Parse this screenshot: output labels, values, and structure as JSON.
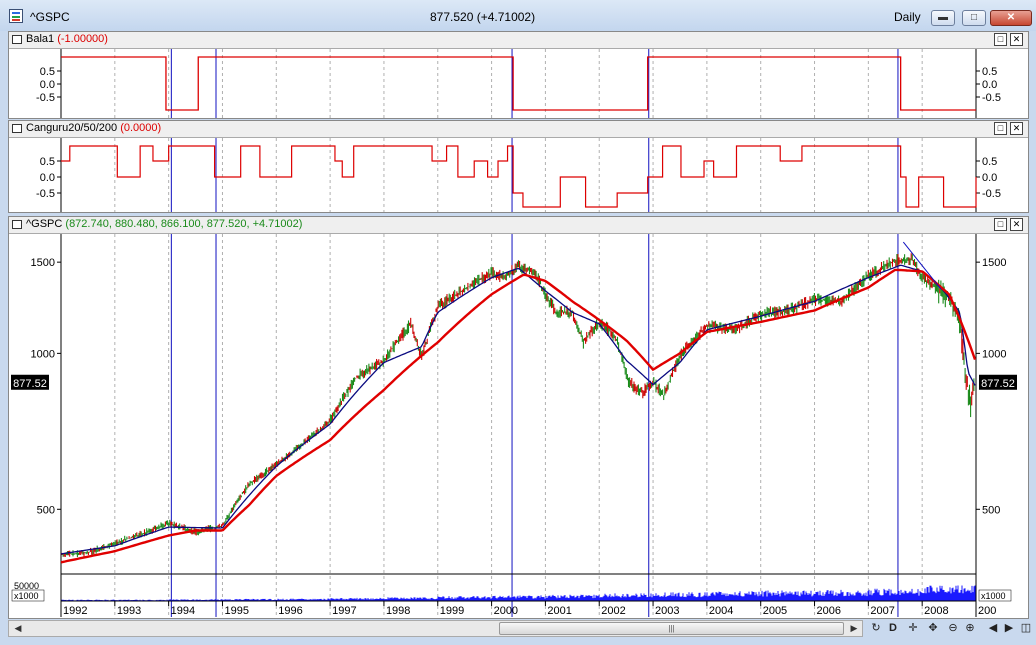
{
  "window": {
    "title": "^GSPC",
    "last_change": "877.520 (+4.71002)",
    "period": "Daily",
    "min_icon": "minimize-icon",
    "max_icon": "maximize-icon",
    "close_icon": "close-icon"
  },
  "panes": {
    "bala": {
      "name": "Bala1",
      "value": "(-1.00000)"
    },
    "canguru": {
      "name": "Canguru20/50/200",
      "value": "(0.0000)"
    },
    "price": {
      "name": "^GSPC",
      "values": "(872.740, 880.480, 866.100, 877.520, +4.71002)"
    },
    "volume": {
      "scale_label": "x1000",
      "top_label": "50000"
    }
  },
  "toolbar": {
    "buttons": [
      "refresh-icon",
      "D",
      "crosshair-icon",
      "zoom-out-icon",
      "zoom-in-icon",
      "prev-icon",
      "next-icon",
      "split-icon"
    ]
  },
  "colors": {
    "signal": "#dd0000",
    "price_up": "#1a8a1a",
    "price_down": "#cc0000",
    "ma_fast": "#0a0a80",
    "ma_slow": "#e00000",
    "marker": "#1010c0",
    "volume": "#1a1aff"
  },
  "chart_data": [
    {
      "type": "line",
      "title": "Bala1",
      "x_domain": [
        1992.0,
        2009.0
      ],
      "yticks": [
        "0.5",
        "0.0",
        "-0.5"
      ],
      "ylim": [
        -1,
        1
      ],
      "steps": [
        [
          1992.0,
          1
        ],
        [
          1993.95,
          -1
        ],
        [
          1994.55,
          1
        ],
        [
          2000.4,
          -1
        ],
        [
          2002.9,
          1
        ],
        [
          2007.6,
          -1
        ],
        [
          2009.0,
          -1
        ]
      ]
    },
    {
      "type": "line",
      "title": "Canguru20/50/200",
      "x_domain": [
        1992.0,
        2009.0
      ],
      "yticks": [
        "0.5",
        "0.0",
        "-0.5"
      ],
      "ylim": [
        -1,
        1
      ],
      "regimes": [
        [
          1992.0,
          2000.4,
          "up"
        ],
        [
          2000.4,
          2002.9,
          "down"
        ],
        [
          2002.9,
          2007.6,
          "up"
        ],
        [
          2007.6,
          2009.0,
          "down"
        ]
      ],
      "current": 0
    },
    {
      "type": "line",
      "title": "^GSPC",
      "scale": "log",
      "yticks": [
        1500,
        1000,
        500
      ],
      "ylim": [
        375,
        1700
      ],
      "last_value": 877.52,
      "last_label": "877.52",
      "xticks": [
        "1992",
        "1993",
        "1994",
        "1995",
        "1996",
        "1997",
        "1998",
        "1999",
        "2000",
        "2001",
        "2002",
        "2003",
        "2004",
        "2005",
        "2006",
        "2007",
        "2008",
        "200"
      ],
      "xtick_positions": [
        1992,
        1993,
        1994,
        1995,
        1996,
        1997,
        1998,
        1999,
        2000,
        2001,
        2002,
        2003,
        2004,
        2005,
        2006,
        2007,
        2008,
        2009
      ],
      "markers": [
        1994.05,
        1994.88,
        2000.38,
        2002.92,
        2007.55
      ],
      "series": [
        {
          "name": "price",
          "x": [
            1992.0,
            1992.5,
            1993.0,
            1993.5,
            1994.0,
            1994.5,
            1995.0,
            1995.5,
            1996.0,
            1996.5,
            1997.0,
            1997.5,
            1998.0,
            1998.5,
            1998.7,
            1999.0,
            1999.5,
            2000.0,
            2000.2,
            2000.5,
            2000.8,
            2001.0,
            2001.2,
            2001.5,
            2001.7,
            2002.0,
            2002.3,
            2002.55,
            2002.8,
            2003.0,
            2003.2,
            2003.5,
            2004.0,
            2004.5,
            2005.0,
            2005.5,
            2006.0,
            2006.5,
            2007.0,
            2007.5,
            2007.8,
            2008.0,
            2008.3,
            2008.5,
            2008.7,
            2008.8,
            2008.9,
            2009.0
          ],
          "values": [
            410,
            412,
            430,
            448,
            470,
            452,
            465,
            560,
            610,
            670,
            740,
            900,
            970,
            1140,
            980,
            1230,
            1330,
            1430,
            1400,
            1470,
            1430,
            1300,
            1200,
            1200,
            1050,
            1150,
            1080,
            880,
            840,
            880,
            830,
            990,
            1130,
            1110,
            1190,
            1210,
            1270,
            1260,
            1410,
            1510,
            1520,
            1400,
            1330,
            1280,
            1150,
            900,
            800,
            877.52
          ]
        },
        {
          "name": "ma-fast",
          "x": [
            1992.0,
            1993.0,
            1994.0,
            1995.0,
            1996.0,
            1997.0,
            1998.0,
            1998.7,
            1999.0,
            2000.0,
            2000.5,
            2001.0,
            2001.5,
            2002.0,
            2002.5,
            2003.0,
            2003.5,
            2004.0,
            2005.0,
            2006.0,
            2007.0,
            2007.6,
            2008.0,
            2008.4,
            2008.7,
            2008.85,
            2009.0
          ],
          "values": [
            410,
            425,
            462,
            460,
            605,
            730,
            960,
            1030,
            1200,
            1400,
            1460,
            1320,
            1200,
            1140,
            970,
            870,
            960,
            1110,
            1180,
            1260,
            1400,
            1480,
            1440,
            1320,
            1200,
            920,
            860
          ]
        },
        {
          "name": "ma-slow",
          "x": [
            1992.0,
            1993.0,
            1994.0,
            1994.5,
            1995.0,
            1995.5,
            1996.0,
            1997.0,
            1998.0,
            1999.0,
            2000.0,
            2000.6,
            2001.0,
            2001.5,
            2002.0,
            2002.5,
            2003.0,
            2003.5,
            2004.0,
            2005.0,
            2006.0,
            2007.0,
            2007.5,
            2008.0,
            2008.5,
            2009.0
          ],
          "values": [
            395,
            415,
            445,
            455,
            455,
            510,
            580,
            680,
            850,
            1050,
            1300,
            1420,
            1380,
            1260,
            1160,
            1060,
            930,
            1000,
            1100,
            1150,
            1210,
            1340,
            1450,
            1440,
            1300,
            960
          ]
        }
      ]
    },
    {
      "type": "bar",
      "title": "volume",
      "x_domain": [
        1992.0,
        2009.0
      ],
      "values_relative": [
        0.04,
        0.04,
        0.05,
        0.06,
        0.07,
        0.09,
        0.11,
        0.14,
        0.16,
        0.18,
        0.22,
        0.25,
        0.28,
        0.3,
        0.32,
        0.35,
        0.45,
        0.7,
        0.9
      ]
    }
  ]
}
